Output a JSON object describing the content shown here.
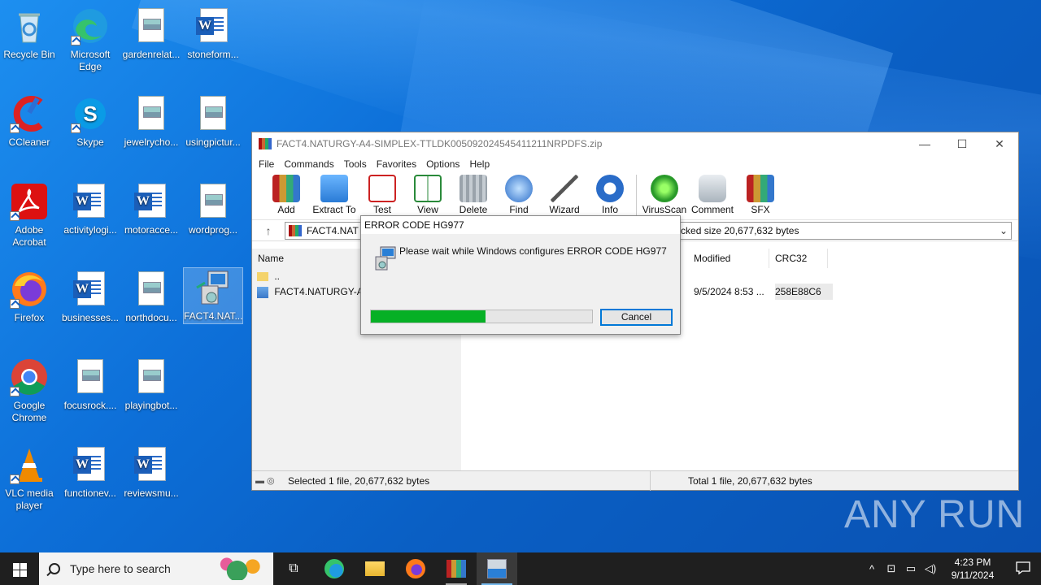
{
  "desktop": {
    "icons": [
      {
        "label": "Recycle Bin"
      },
      {
        "label": "Microsoft Edge"
      },
      {
        "label": "gardenrelat..."
      },
      {
        "label": "stoneform..."
      },
      {
        "label": "CCleaner"
      },
      {
        "label": "Skype"
      },
      {
        "label": "jewelrycho..."
      },
      {
        "label": "usingpictur..."
      },
      {
        "label": "Adobe Acrobat"
      },
      {
        "label": "activitylogi..."
      },
      {
        "label": "motoracce..."
      },
      {
        "label": "wordprog..."
      },
      {
        "label": "Firefox"
      },
      {
        "label": "businesses..."
      },
      {
        "label": "northdocu..."
      },
      {
        "label": "FACT4.NAT..."
      },
      {
        "label": "Google Chrome"
      },
      {
        "label": "focusrock...."
      },
      {
        "label": "playingbot..."
      },
      {
        "label": "VLC media player"
      },
      {
        "label": "functionev..."
      },
      {
        "label": "reviewsmu..."
      }
    ]
  },
  "winrar": {
    "title": "FACT4.NATURGY-A4-SIMPLEX-TTLDK005092024545411211NRPDFS.zip",
    "controls": {
      "minimize": "—",
      "maximize": "☐",
      "close": "✕"
    },
    "menu": [
      "File",
      "Commands",
      "Tools",
      "Favorites",
      "Options",
      "Help"
    ],
    "toolbar": [
      "Add",
      "Extract To",
      "Test",
      "View",
      "Delete",
      "Find",
      "Wizard",
      "Info",
      "VirusScan",
      "Comment",
      "SFX"
    ],
    "address": {
      "path": "FACT4.NAT",
      "size_text": "npacked size 20,677,632 bytes"
    },
    "columns": {
      "name": "Name",
      "modified": "Modified",
      "crc": "CRC32"
    },
    "rows": [
      {
        "name": "..",
        "modified": "",
        "crc": ""
      },
      {
        "name": "FACT4.NATURGY-A4-",
        "modified": "9/5/2024 8:53 ...",
        "crc": "258E88C6"
      }
    ],
    "status": {
      "left": "Selected 1 file, 20,677,632 bytes",
      "right": "Total 1 file, 20,677,632 bytes"
    }
  },
  "dialog": {
    "title": "ERROR CODE HG977",
    "message": "Please wait while Windows configures ERROR CODE HG977",
    "progress": 0.52,
    "cancel": "Cancel"
  },
  "taskbar": {
    "search_placeholder": "Type here to search",
    "time": "4:23 PM",
    "date": "9/11/2024"
  },
  "watermark": "ANY RUN",
  "colors": {
    "desktop": "#0d6fd8",
    "progress": "#06b025",
    "accent": "#0078d7",
    "taskbar": "#1f1f1f"
  }
}
